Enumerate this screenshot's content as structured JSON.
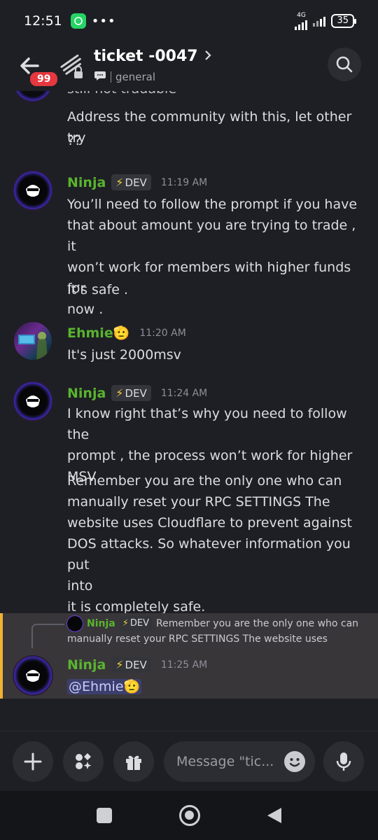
{
  "status_bar": {
    "time": "12:51",
    "network": "4G",
    "battery": "35"
  },
  "header": {
    "back_badge": "99",
    "title": "ticket -0047",
    "channel": "general"
  },
  "messages": [
    {
      "partial_top_text": "still not tradable",
      "text_1": "Address the community with this, let other try",
      "text_2": "??"
    },
    {
      "author": "Ninja",
      "tag": "DEV",
      "time": "11:19 AM",
      "lines": [
        "You’ll need to follow the prompt if you have",
        "that about amount you are trying to trade , it",
        "won’t work for members with higher funds for",
        "now ."
      ],
      "line_extra": "It’s safe ."
    },
    {
      "author": "Ehmie🫡",
      "time": "11:20 AM",
      "text": "It's just 2000msv"
    },
    {
      "author": "Ninja",
      "tag": "DEV",
      "time": "11:24 AM",
      "para1": [
        "I know right that’s why you need to follow the",
        "prompt , the process won’t work for higher",
        "MSV"
      ],
      "para2": [
        "Remember you are the only one who can",
        "manually reset your  RPC SETTINGS The",
        "website uses Cloudflare to prevent against",
        "DOS attacks. So whatever information you put",
        "into",
        "it is completely safe."
      ]
    },
    {
      "reply_author": "Ninja",
      "reply_tag": "DEV",
      "reply_line1": "Remember you are the only one who can",
      "reply_line2": "manually reset your  RPC SETTINGS The website uses",
      "author": "Ninja",
      "tag": "DEV",
      "time": "11:25 AM",
      "mention": "@Ehmie🫡"
    }
  ],
  "composer": {
    "placeholder": "Message \"tic..."
  },
  "colors": {
    "background": "#1e1f24",
    "username_green": "#59b42f",
    "highlight_border": "#f0b232",
    "badge_red": "#e5383f"
  }
}
